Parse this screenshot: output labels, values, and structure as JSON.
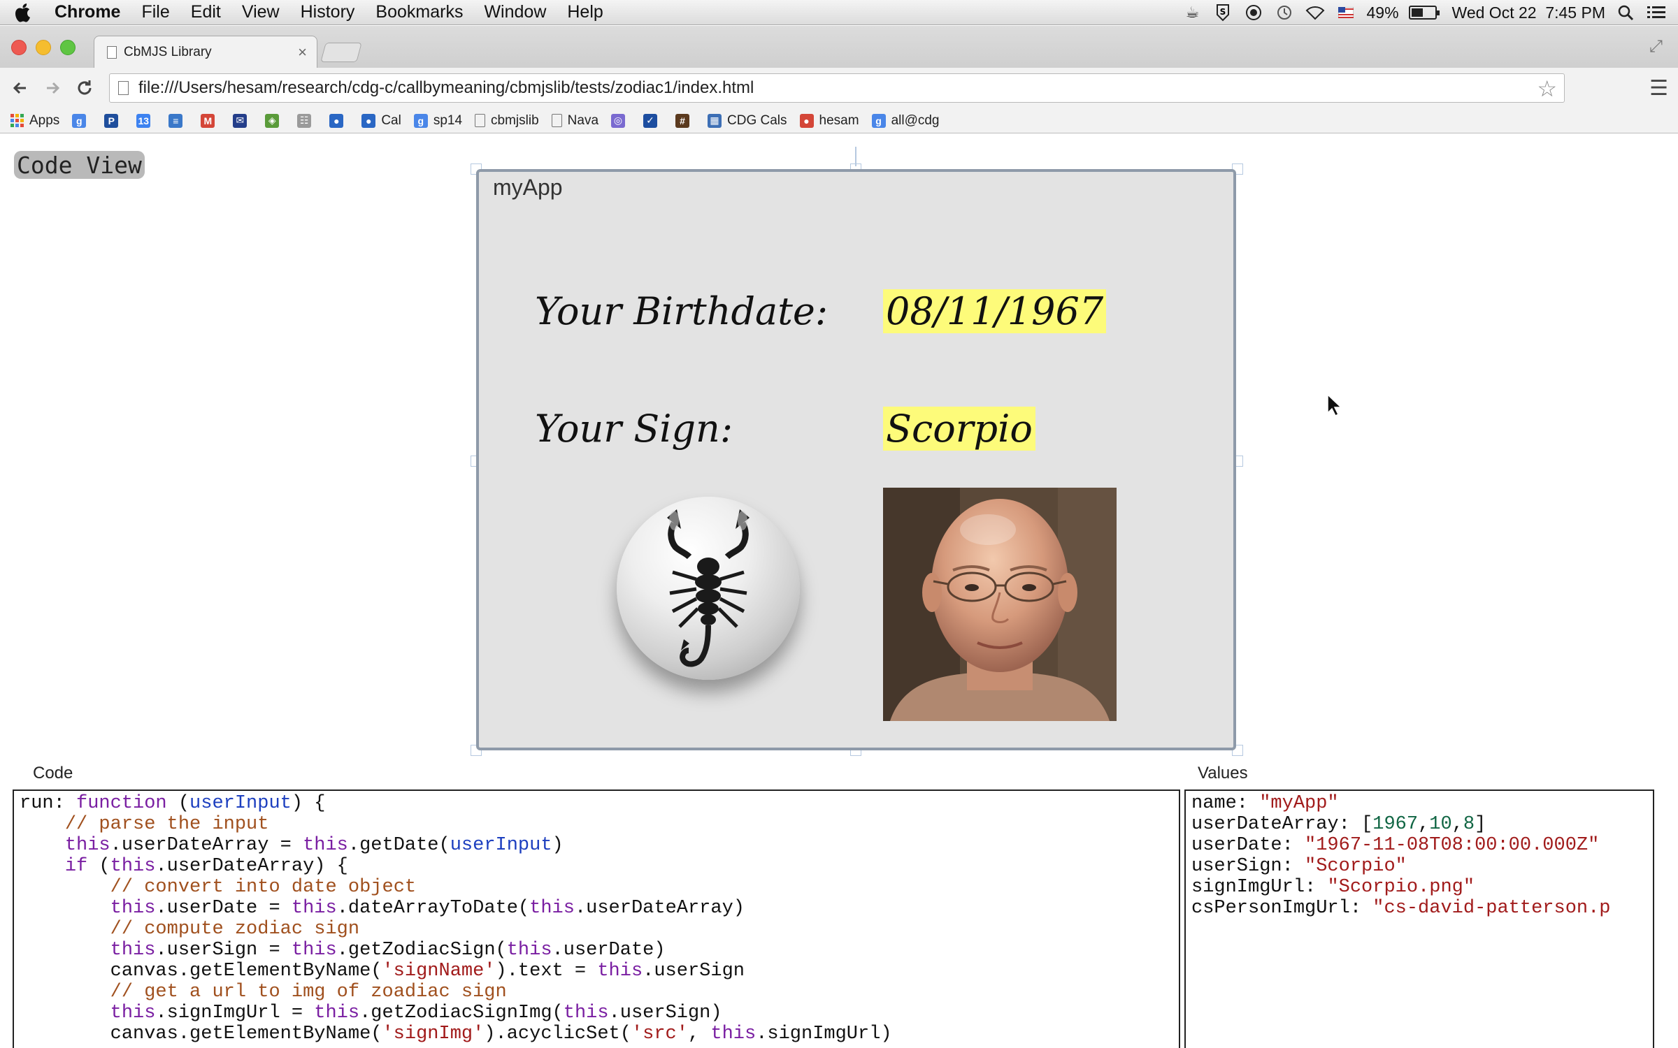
{
  "menubar": {
    "app_name": "Chrome",
    "items": [
      "File",
      "Edit",
      "View",
      "History",
      "Bookmarks",
      "Window",
      "Help"
    ],
    "battery_percent": "49%",
    "battery_level": 0.49,
    "datetime": "Wed Oct 22  7:45 PM",
    "status_icons": [
      "coffee-icon",
      "s-icon",
      "record-icon",
      "time-machine-icon",
      "wifi-icon",
      "flag-icon",
      "battery-icon",
      "search-icon",
      "list-icon"
    ]
  },
  "browser": {
    "tab_title": "CbMJS Library",
    "tab_close": "×",
    "url": "file:///Users/hesam/research/cdg-c/callbymeaning/cbmjslib/tests/zodiac1/index.html"
  },
  "bookmarks": [
    {
      "label": "Apps",
      "icon": "apps-icon",
      "color": ""
    },
    {
      "label": "",
      "icon": "g",
      "color": "#4a86e8"
    },
    {
      "label": "",
      "icon": "P",
      "color": "#1f4e9c"
    },
    {
      "label": "",
      "icon": "13",
      "color": "#3d82f0"
    },
    {
      "label": "",
      "icon": "≡",
      "color": "#3a78c9"
    },
    {
      "label": "",
      "icon": "M",
      "color": "#d44638"
    },
    {
      "label": "",
      "icon": "✉",
      "color": "#243e8a"
    },
    {
      "label": "",
      "icon": "◈",
      "color": "#5a9b3a"
    },
    {
      "label": "",
      "icon": "☷",
      "color": "#9a9a9a"
    },
    {
      "label": "",
      "icon": "●",
      "color": "#2a67c4"
    },
    {
      "label": "Cal",
      "icon": "●",
      "color": "#2a67c4"
    },
    {
      "label": "sp14",
      "icon": "g",
      "color": "#4a86e8"
    },
    {
      "label": "cbmjslib",
      "icon": "folder",
      "color": ""
    },
    {
      "label": "Nava",
      "icon": "folder",
      "color": ""
    },
    {
      "label": "",
      "icon": "◎",
      "color": "#7a6ad0"
    },
    {
      "label": "",
      "icon": "✓",
      "color": "#1d4ea0"
    },
    {
      "label": "",
      "icon": "#",
      "color": "#5b3a1e"
    },
    {
      "label": "CDG Cals",
      "icon": "▦",
      "color": "#3d6fb5"
    },
    {
      "label": "hesam",
      "icon": "●",
      "color": "#d44638"
    },
    {
      "label": "all@cdg",
      "icon": "g",
      "color": "#4a86e8"
    }
  ],
  "page": {
    "code_view_button": "Code View",
    "canvas_title": "myApp",
    "birthdate_label": "Your Birthdate:",
    "birthdate_value": "08/11/1967",
    "sign_label": "Your Sign:",
    "sign_value": "Scorpio",
    "code_label": "Code",
    "values_label": "Values",
    "highlight_color": "#fdfb7a"
  },
  "code": {
    "lines": [
      [
        {
          "t": "run: "
        },
        {
          "t": "function",
          "c": "kw"
        },
        {
          "t": " ("
        },
        {
          "t": "userInput",
          "c": "var"
        },
        {
          "t": ") {"
        }
      ],
      [
        {
          "t": "    "
        },
        {
          "t": "// parse the input",
          "c": "cm"
        }
      ],
      [
        {
          "t": "    "
        },
        {
          "t": "this",
          "c": "kw"
        },
        {
          "t": ".userDateArray = "
        },
        {
          "t": "this",
          "c": "kw"
        },
        {
          "t": ".getDate("
        },
        {
          "t": "userInput",
          "c": "var"
        },
        {
          "t": ")"
        }
      ],
      [
        {
          "t": "    "
        },
        {
          "t": "if",
          "c": "kw"
        },
        {
          "t": " ("
        },
        {
          "t": "this",
          "c": "kw"
        },
        {
          "t": ".userDateArray) {"
        }
      ],
      [
        {
          "t": "        "
        },
        {
          "t": "// convert into date object",
          "c": "cm"
        }
      ],
      [
        {
          "t": "        "
        },
        {
          "t": "this",
          "c": "kw"
        },
        {
          "t": ".userDate = "
        },
        {
          "t": "this",
          "c": "kw"
        },
        {
          "t": ".dateArrayToDate("
        },
        {
          "t": "this",
          "c": "kw"
        },
        {
          "t": ".userDateArray)"
        }
      ],
      [
        {
          "t": "        "
        },
        {
          "t": "// compute zodiac sign",
          "c": "cm"
        }
      ],
      [
        {
          "t": "        "
        },
        {
          "t": "this",
          "c": "kw"
        },
        {
          "t": ".userSign = "
        },
        {
          "t": "this",
          "c": "kw"
        },
        {
          "t": ".getZodiacSign("
        },
        {
          "t": "this",
          "c": "kw"
        },
        {
          "t": ".userDate)"
        }
      ],
      [
        {
          "t": "        canvas.getElementByName("
        },
        {
          "t": "'signName'",
          "c": "str"
        },
        {
          "t": ").text = "
        },
        {
          "t": "this",
          "c": "kw"
        },
        {
          "t": ".userSign"
        }
      ],
      [
        {
          "t": "        "
        },
        {
          "t": "// get a url to img of zoadiac sign",
          "c": "cm"
        }
      ],
      [
        {
          "t": "        "
        },
        {
          "t": "this",
          "c": "kw"
        },
        {
          "t": ".signImgUrl = "
        },
        {
          "t": "this",
          "c": "kw"
        },
        {
          "t": ".getZodiacSignImg("
        },
        {
          "t": "this",
          "c": "kw"
        },
        {
          "t": ".userSign)"
        }
      ],
      [
        {
          "t": "        canvas.getElementByName("
        },
        {
          "t": "'signImg'",
          "c": "str"
        },
        {
          "t": ").acyclicSet("
        },
        {
          "t": "'src'",
          "c": "str"
        },
        {
          "t": ", "
        },
        {
          "t": "this",
          "c": "kw"
        },
        {
          "t": ".signImgUrl)"
        }
      ]
    ]
  },
  "values": {
    "lines": [
      [
        {
          "t": "name: "
        },
        {
          "t": "\"myApp\"",
          "c": "str"
        }
      ],
      [
        {
          "t": "userDateArray: ["
        },
        {
          "t": "1967",
          "c": "num"
        },
        {
          "t": ","
        },
        {
          "t": "10",
          "c": "num"
        },
        {
          "t": ","
        },
        {
          "t": "8",
          "c": "num"
        },
        {
          "t": "]"
        }
      ],
      [
        {
          "t": "userDate: "
        },
        {
          "t": "\"1967-11-08T08:00:00.000Z\"",
          "c": "str"
        }
      ],
      [
        {
          "t": "userSign: "
        },
        {
          "t": "\"Scorpio\"",
          "c": "str"
        }
      ],
      [
        {
          "t": "signImgUrl: "
        },
        {
          "t": "\"Scorpio.png\"",
          "c": "str"
        }
      ],
      [
        {
          "t": "csPersonImgUrl: "
        },
        {
          "t": "\"cs-david-patterson.p",
          "c": "str"
        }
      ]
    ]
  }
}
